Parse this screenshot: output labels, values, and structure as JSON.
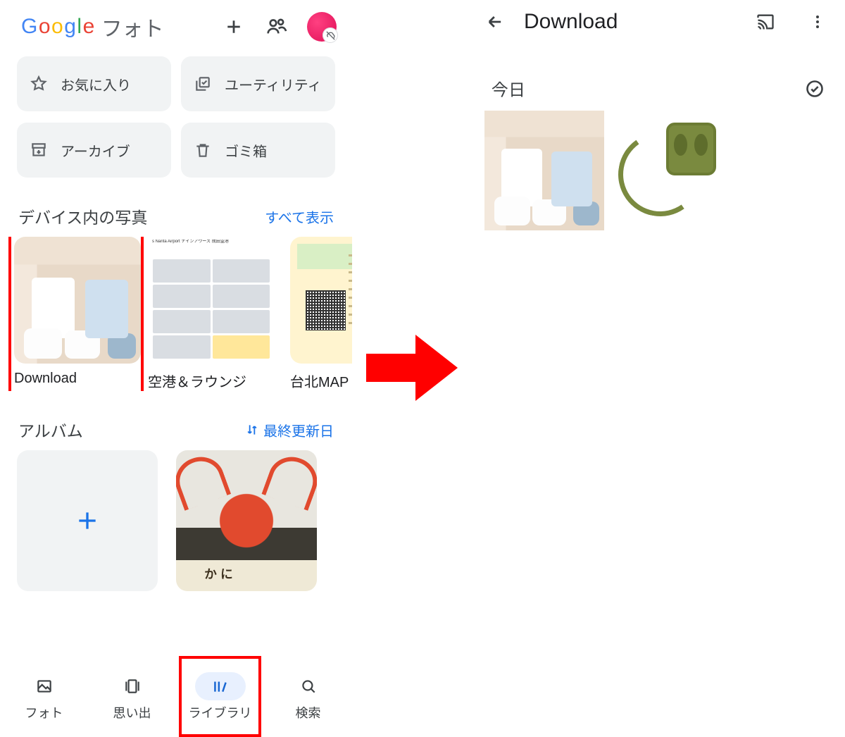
{
  "left": {
    "logo_suffix": "フォト",
    "chips": {
      "favorites": "お気に入り",
      "utilities": "ユーティリティ",
      "archive": "アーカイブ",
      "trash": "ゴミ箱"
    },
    "device_section": {
      "title": "デバイス内の写真",
      "show_all": "すべて表示",
      "folders": [
        {
          "label": "Download"
        },
        {
          "label": "空港＆ラウンジ"
        },
        {
          "label": "台北MAP"
        }
      ]
    },
    "albums_section": {
      "title": "アルバム",
      "sort_label": "最終更新日"
    },
    "nav": {
      "photos": "フォト",
      "memories": "思い出",
      "library": "ライブラリ",
      "search": "検索"
    },
    "airport_header": "s Narita Airport ナインアワーズ 成田空港",
    "crab_sign": "か に"
  },
  "right": {
    "title": "Download",
    "section": "今日"
  }
}
